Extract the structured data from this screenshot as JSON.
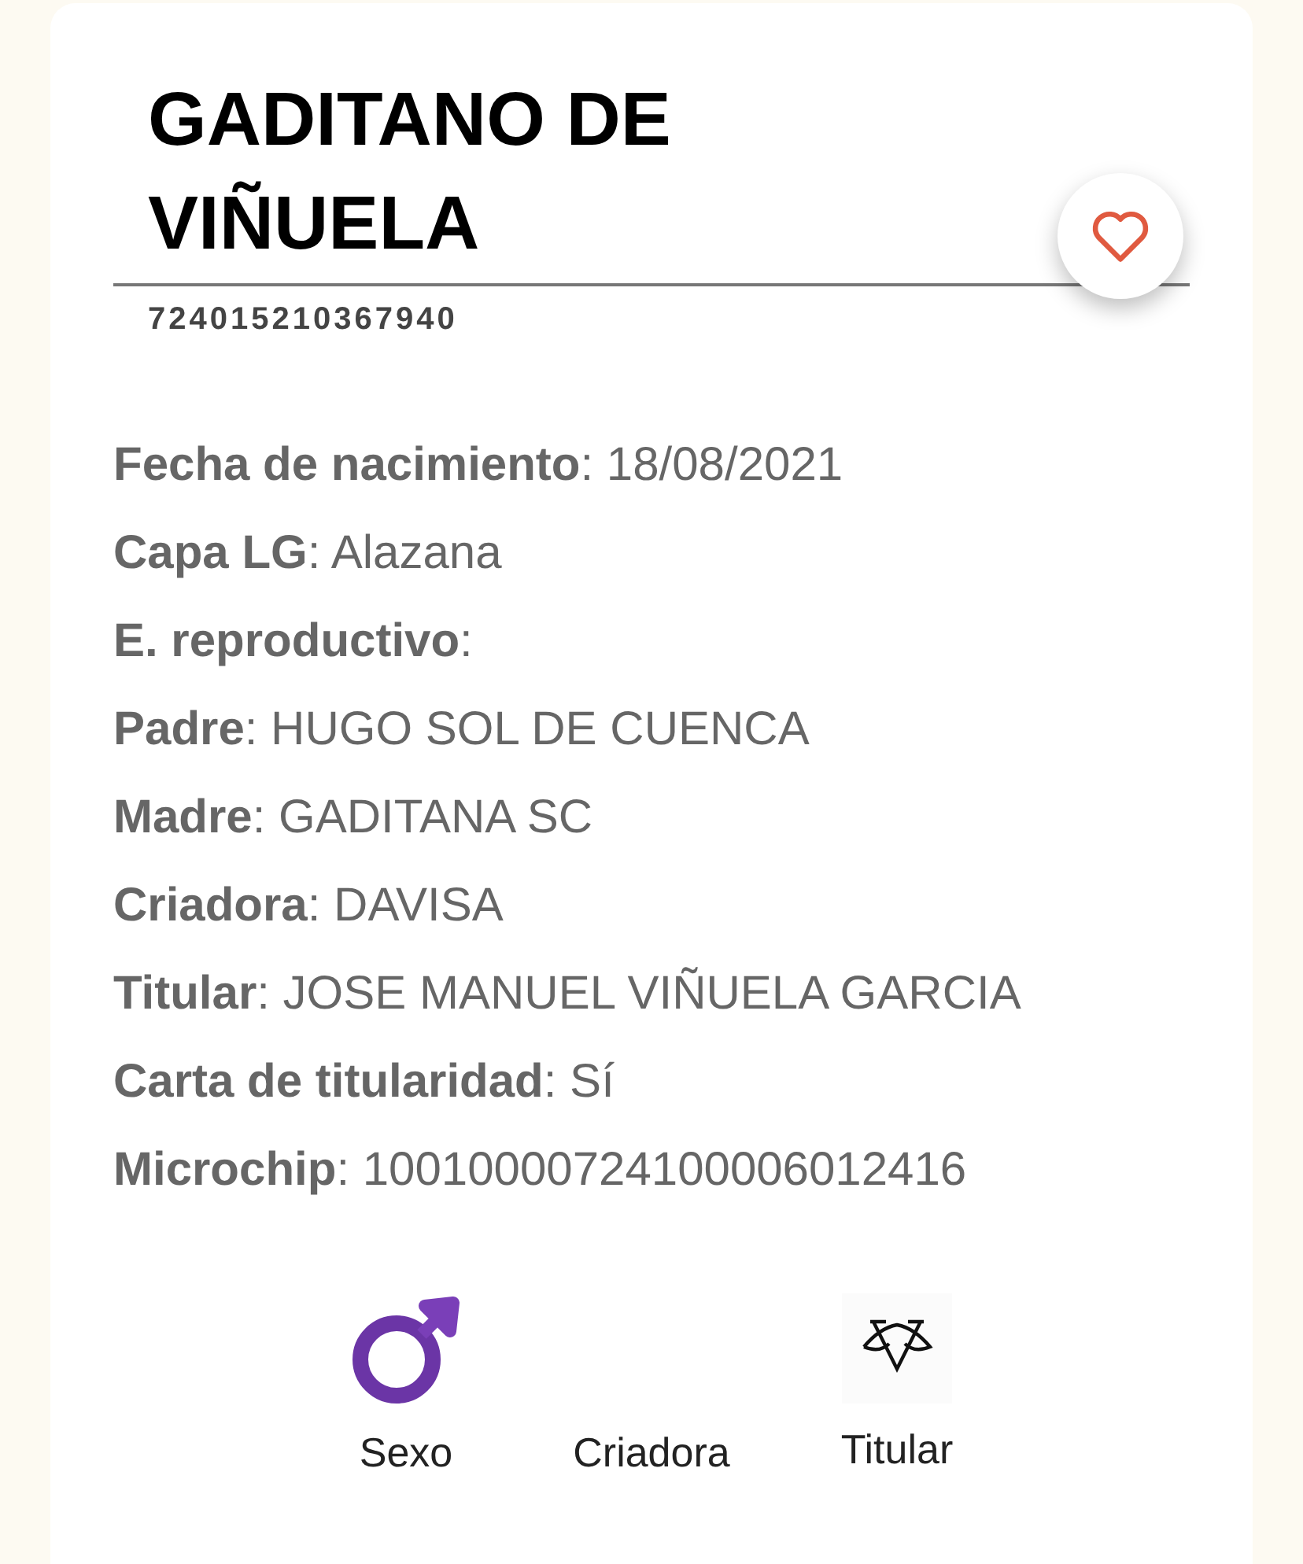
{
  "title": "GADITANO DE VIÑUELA",
  "id_number": "724015210367940",
  "favorite": {
    "on": false
  },
  "fields": [
    {
      "label": "Fecha de nacimiento",
      "value": ": 18/08/2021"
    },
    {
      "label": "Capa LG",
      "value": ": Alazana"
    },
    {
      "label": "E. reproductivo",
      "value": ":"
    },
    {
      "label": "Padre",
      "value": ": HUGO SOL DE CUENCA"
    },
    {
      "label": "Madre",
      "value": ": GADITANA SC"
    },
    {
      "label": "Criadora",
      "value": ": DAVISA"
    },
    {
      "label": "Titular",
      "value": ": JOSE MANUEL VIÑUELA GARCIA"
    },
    {
      "label": "Carta de titularidad",
      "value": ": Sí"
    },
    {
      "label": "Microchip",
      "value": ": 10010000724100006012416"
    }
  ],
  "badges": [
    {
      "kind": "male",
      "label": "Sexo"
    },
    {
      "kind": "none",
      "label": "Criadora"
    },
    {
      "kind": "logo",
      "label": "Titular"
    }
  ]
}
